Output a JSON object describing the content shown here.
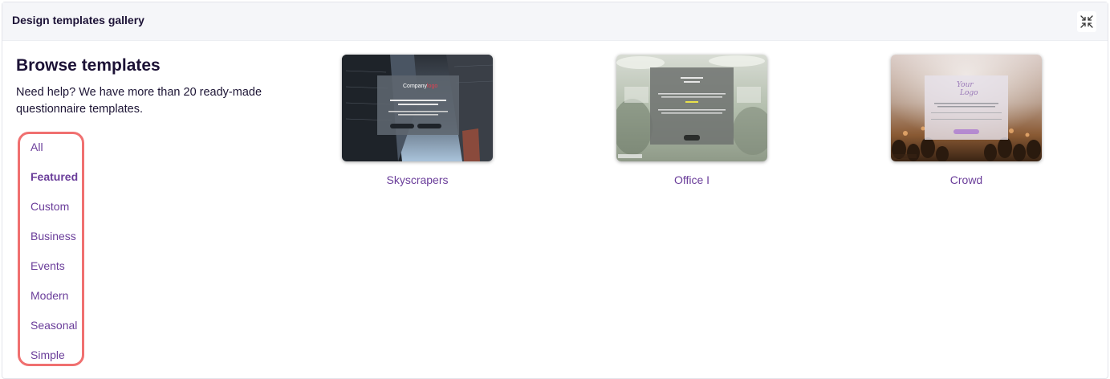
{
  "header": {
    "title": "Design templates gallery",
    "collapse_icon": "collapse-arrows-icon"
  },
  "sidebar": {
    "title": "Browse templates",
    "help_text": "Need help? We have more than 20 ready-made questionnaire templates.",
    "highlight_color": "#f07070",
    "categories": [
      {
        "label": "All",
        "active": false
      },
      {
        "label": "Featured",
        "active": true
      },
      {
        "label": "Custom",
        "active": false
      },
      {
        "label": "Business",
        "active": false
      },
      {
        "label": "Events",
        "active": false
      },
      {
        "label": "Modern",
        "active": false
      },
      {
        "label": "Seasonal",
        "active": false
      },
      {
        "label": "Simple",
        "active": false
      }
    ]
  },
  "templates": [
    {
      "name": "Skyscrapers"
    },
    {
      "name": "Office I"
    },
    {
      "name": "Crowd"
    }
  ],
  "colors": {
    "link": "#6a3d9a",
    "heading": "#1c1236",
    "header_bg": "#f5f6f9"
  }
}
